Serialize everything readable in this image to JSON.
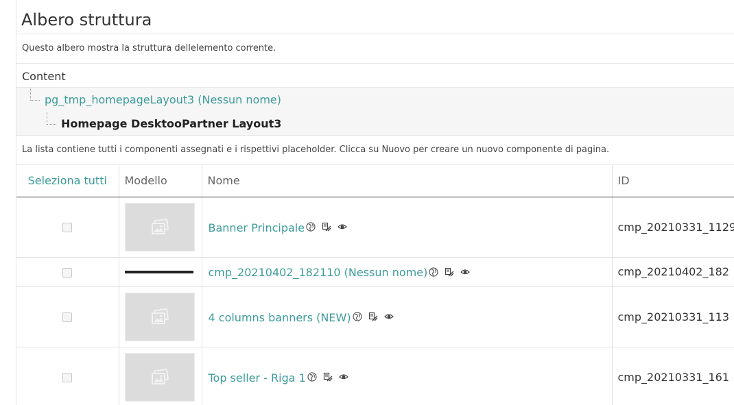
{
  "page": {
    "title": "Albero struttura",
    "description": "Questo albero mostra la struttura dellelemento corrente."
  },
  "tree": {
    "root_label": "Content",
    "node1_label": "pg_tmp_homepageLayout3 (Nessun nome)",
    "node2_label": "Homepage DesktooPartner Layout3"
  },
  "list": {
    "description": "La lista contiene tutti i componenti assegnati e i rispettivi placeholder. Clicca su Nuovo per creare un nuovo componente di pagina.",
    "headers": {
      "select_all": "Seleziona tutti",
      "model": "Modello",
      "name": "Nome",
      "id": "ID"
    },
    "rows": [
      {
        "name": "Banner Principale",
        "id": "cmp_20210331_1129",
        "thumbnail": "image-placeholder-icon"
      },
      {
        "name": "cmp_20210402_182110 (Nessun nome)",
        "id": "cmp_20210402_182",
        "thumbnail": "strip-preview"
      },
      {
        "name": "4 columns banners (NEW)",
        "id": "cmp_20210331_113",
        "thumbnail": "image-placeholder-icon"
      },
      {
        "name": "Top seller - Riga 1",
        "id": "cmp_20210331_161",
        "thumbnail": "image-placeholder-icon"
      }
    ],
    "row_actions": [
      "globe-icon",
      "edit-component-icon",
      "eye-icon"
    ]
  },
  "colors": {
    "link": "#3d9b9b",
    "thumbnail_bg": "#dcdcdc"
  }
}
